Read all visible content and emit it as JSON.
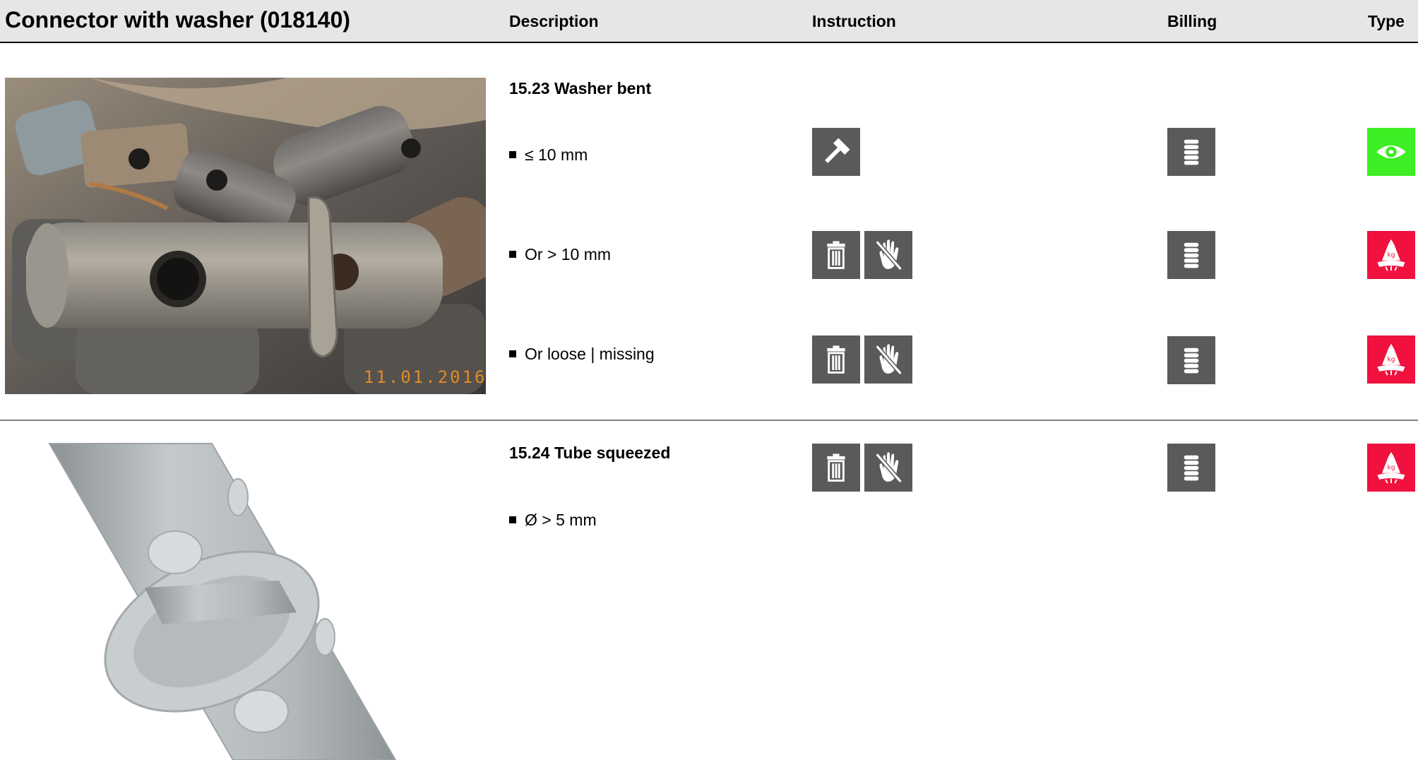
{
  "header": {
    "title": "Connector with washer (018140)",
    "col_description": "Description",
    "col_instruction": "Instruction",
    "col_billing": "Billing",
    "col_type": "Type"
  },
  "section1": {
    "heading": "15.23 Washer bent",
    "photo_date": "11.01.2016",
    "rows": [
      {
        "text": "≤ 10 mm",
        "instruction": [
          "hammer-icon"
        ],
        "billing": "coins-icon",
        "type": "eye-icon",
        "type_color": "#3cee23"
      },
      {
        "text": "Or > 10 mm",
        "instruction": [
          "trash-icon",
          "no-touch-icon"
        ],
        "billing": "coins-icon",
        "type": "scrap-weight-icon",
        "type_color": "#f0113e"
      },
      {
        "text": "Or loose | missing",
        "instruction": [
          "trash-icon",
          "no-touch-icon"
        ],
        "billing": "coins-icon",
        "type": "scrap-weight-icon",
        "type_color": "#f0113e"
      }
    ]
  },
  "section2": {
    "heading": "15.24 Tube squeezed",
    "rows": [
      {
        "text": "Ø > 5 mm",
        "instruction": [
          "trash-icon",
          "no-touch-icon"
        ],
        "billing": "coins-icon",
        "type": "scrap-weight-icon",
        "type_color": "#f0113e"
      }
    ]
  },
  "colors": {
    "icon_gray": "#5a5a5a",
    "ok_green": "#3cee23",
    "scrap_red": "#f0113e",
    "header_bg": "#e6e6e6"
  }
}
